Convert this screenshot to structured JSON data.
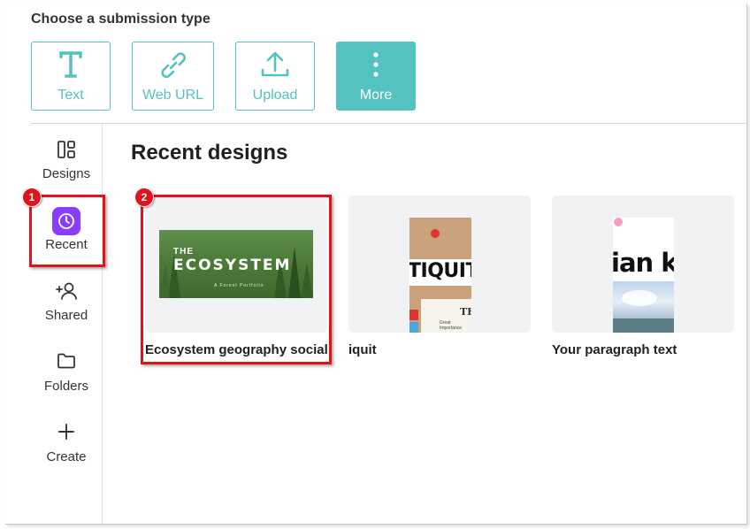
{
  "submission": {
    "title": "Choose a submission type",
    "types": [
      {
        "label": "Text",
        "icon": "text-icon"
      },
      {
        "label": "Web URL",
        "icon": "link-icon"
      },
      {
        "label": "Upload",
        "icon": "upload-icon"
      },
      {
        "label": "More",
        "icon": "more-vertical-icon"
      }
    ]
  },
  "sidebar": {
    "items": [
      {
        "label": "Designs",
        "icon": "designs-icon"
      },
      {
        "label": "Recent",
        "icon": "clock-icon"
      },
      {
        "label": "Shared",
        "icon": "people-icon"
      },
      {
        "label": "Folders",
        "icon": "folder-icon"
      },
      {
        "label": "Create",
        "icon": "plus-icon"
      }
    ]
  },
  "main": {
    "title": "Recent designs",
    "designs": [
      {
        "label": "Ecosystem geography social ...",
        "thumb_title_small": "THE",
        "thumb_title_big": "ECOSYSTEM",
        "thumb_sub": "A Forest Portfolio"
      },
      {
        "label": "iquit",
        "thumb_word": "TIQUIT",
        "thumb_mark": "TE",
        "thumb_tiny": "Great Importance"
      },
      {
        "label": "Your paragraph text",
        "thumb_word": "ian k"
      }
    ]
  },
  "annotations": {
    "badge_1": "1",
    "badge_2": "2"
  },
  "colors": {
    "accent": "#54c2c1",
    "highlight": "#e0121b",
    "recent_tile": "#8b3dff"
  }
}
